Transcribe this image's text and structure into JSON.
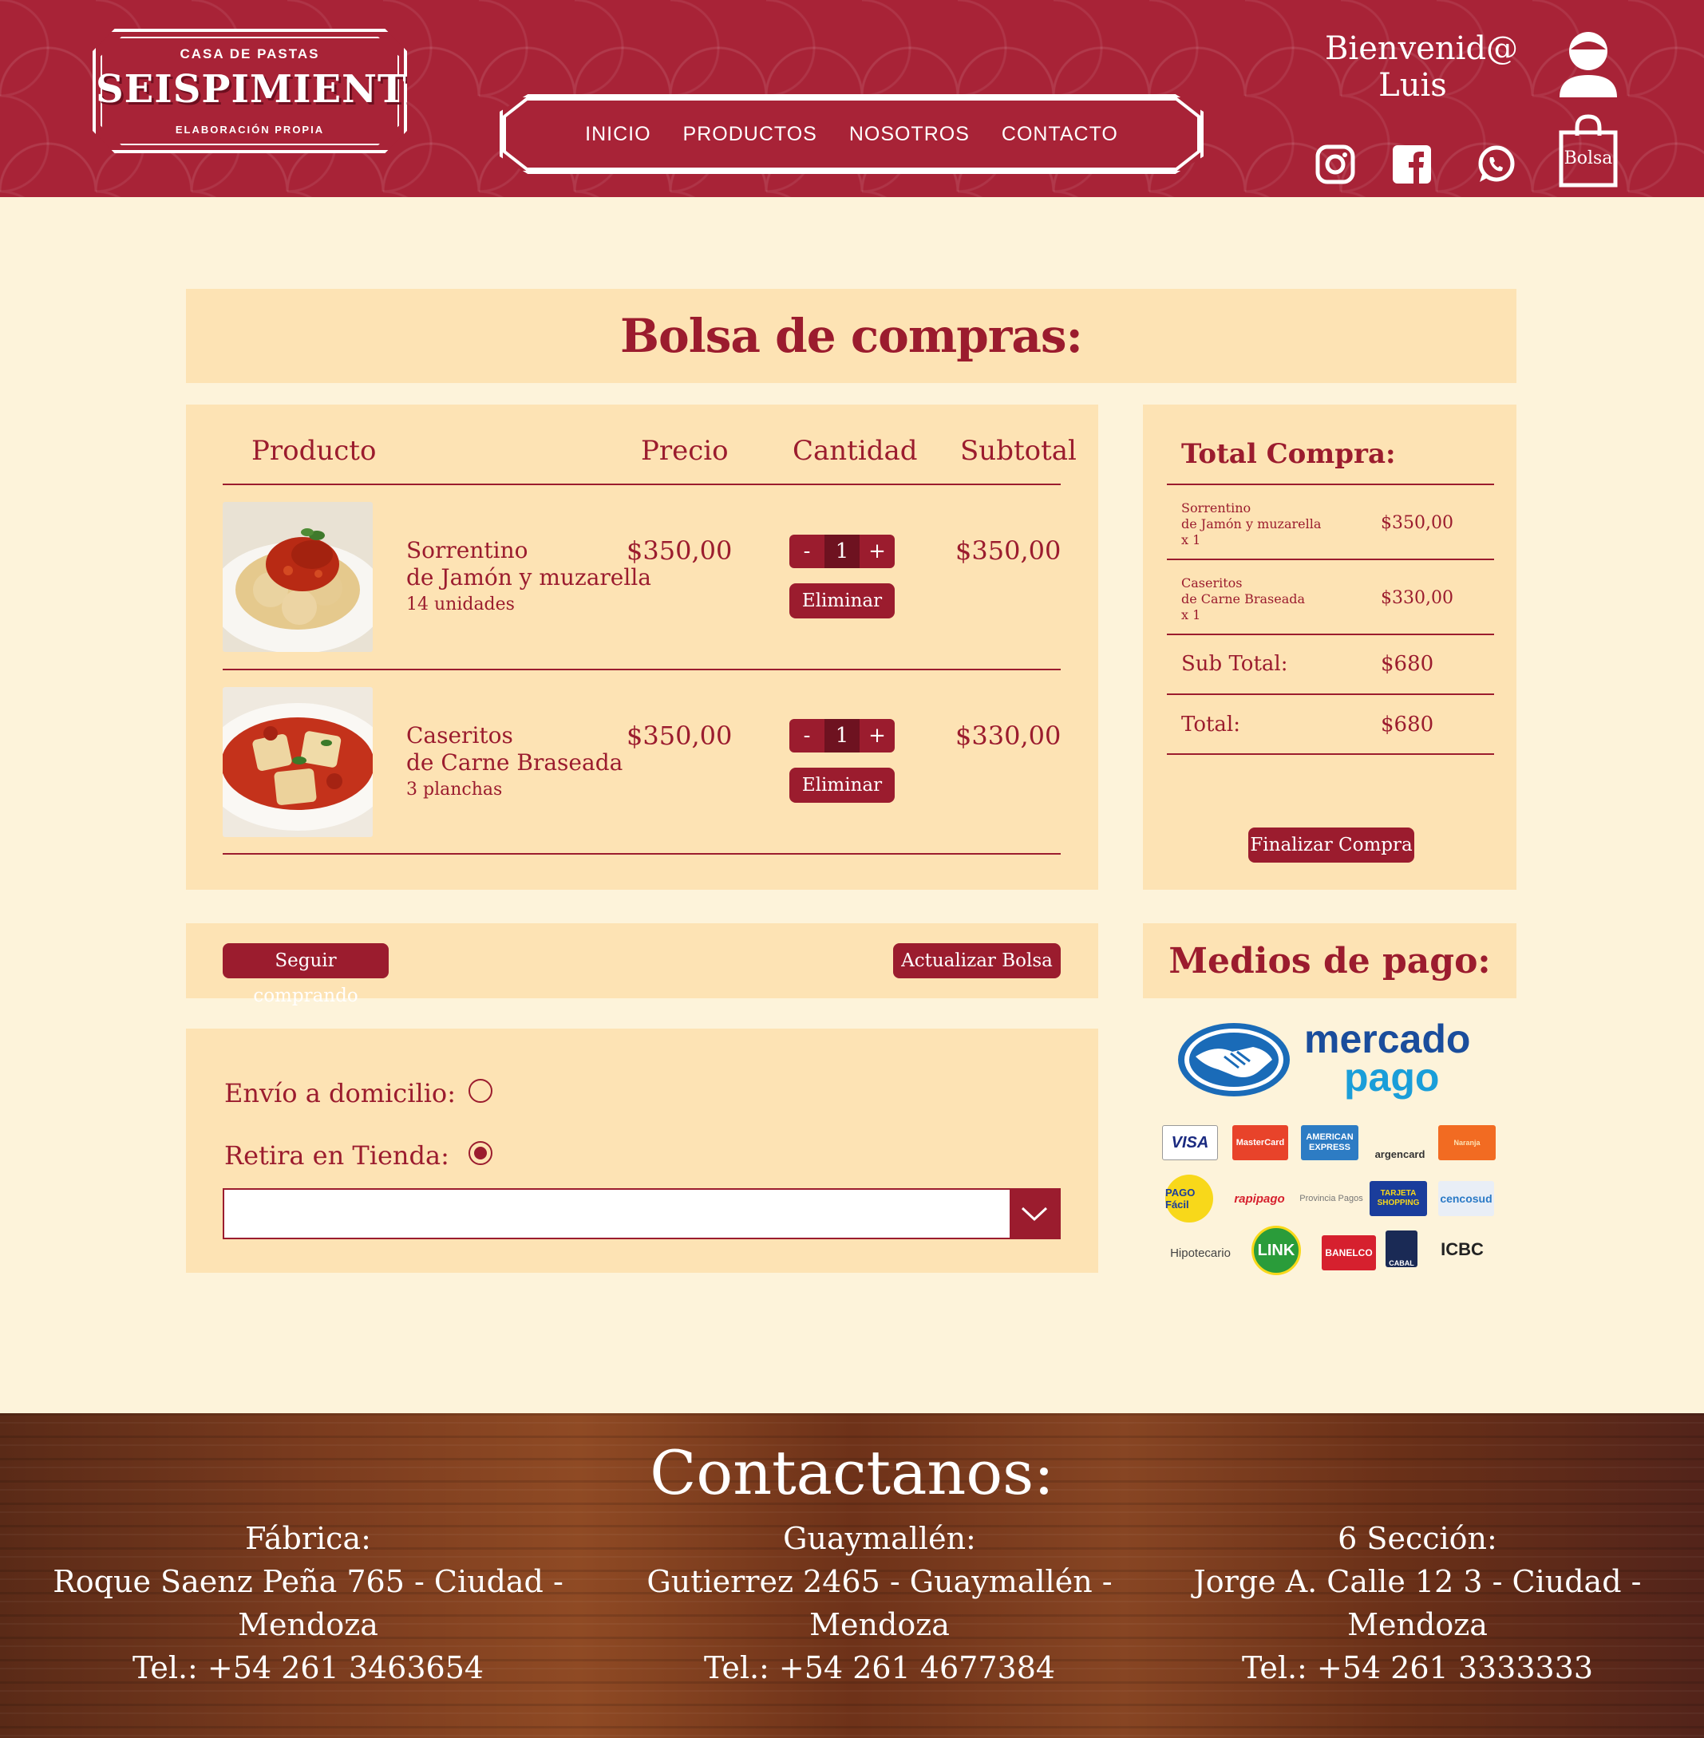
{
  "brand": {
    "top": "CASA DE PASTAS",
    "name": "SEISPIMIENTAS",
    "bottom": "ELABORACIÓN PROPIA"
  },
  "nav": [
    "INICIO",
    "PRODUCTOS",
    "NOSOTROS",
    "CONTACTO"
  ],
  "user": {
    "greeting": "Bienvenid@",
    "name": "Luis",
    "bag_label": "Bolsa"
  },
  "social_icons": [
    "instagram-icon",
    "facebook-icon",
    "whatsapp-icon"
  ],
  "page_title": "Bolsa de compras:",
  "cart": {
    "headers": {
      "product": "Producto",
      "price": "Precio",
      "quantity": "Cantidad",
      "subtotal": "Subtotal"
    },
    "items": [
      {
        "name_line1": "Sorrentino",
        "name_line2": "de Jamón y muzarella",
        "detail": "14 unidades",
        "price": "$350,00",
        "quantity": "1",
        "subtotal": "$350,00",
        "minus": "-",
        "plus": "+",
        "remove": "Eliminar"
      },
      {
        "name_line1": "Caseritos",
        "name_line2": "de Carne Braseada",
        "detail": "3 planchas",
        "price": "$350,00",
        "quantity": "1",
        "subtotal": "$330,00",
        "minus": "-",
        "plus": "+",
        "remove": "Eliminar"
      }
    ]
  },
  "summary": {
    "title": "Total Compra:",
    "items": [
      {
        "line1": "Sorrentino",
        "line2": "de Jamón y muzarella",
        "line3": "x 1",
        "value": "$350,00"
      },
      {
        "line1": "Caseritos",
        "line2": "de Carne Braseada",
        "line3": "x 1",
        "value": "$330,00"
      }
    ],
    "subtotal_label": "Sub Total:",
    "subtotal_value": "$680",
    "total_label": "Total:",
    "total_value": "$680",
    "checkout": "Finalizar Compra"
  },
  "actions": {
    "continue": "Seguir comprando",
    "update": "Actualizar Bolsa"
  },
  "shipping": {
    "home_label": "Envío a domicilio:",
    "store_label": "Retira en Tienda:",
    "selected": "store",
    "store_select_value": ""
  },
  "payment": {
    "title": "Medios de pago:",
    "mp_line1": "mercado",
    "mp_line2": "pago",
    "cards": [
      "VISA",
      "MasterCard",
      "AMERICAN EXPRESS",
      "argencard",
      "Naranja",
      "PAGO Fácil",
      "rapipago",
      "Provincia Pagos",
      "TARJETA SHOPPING",
      "cencosud",
      "Hipotecario",
      "LINK",
      "BANELCO",
      "CABAL",
      "ICBC"
    ]
  },
  "footer": {
    "title": "Contactanos:",
    "locations": [
      {
        "name": "Fábrica:",
        "address": "Roque Saenz Peña 765 - Ciudad - Mendoza",
        "phone": "Tel.: +54 261 3463654"
      },
      {
        "name": "Guaymallén:",
        "address": "Gutierrez 2465 - Guaymallén - Mendoza",
        "phone": "Tel.: +54 261 4677384"
      },
      {
        "name": "6 Sección:",
        "address": "Jorge A. Calle 12 3 - Ciudad - Mendoza",
        "phone": "Tel.: +54 261 3333333"
      }
    ]
  },
  "colors": {
    "brand": "#a82337",
    "accent": "#9b1c2e",
    "panel": "#fde3b4",
    "background": "#fdf3da"
  }
}
